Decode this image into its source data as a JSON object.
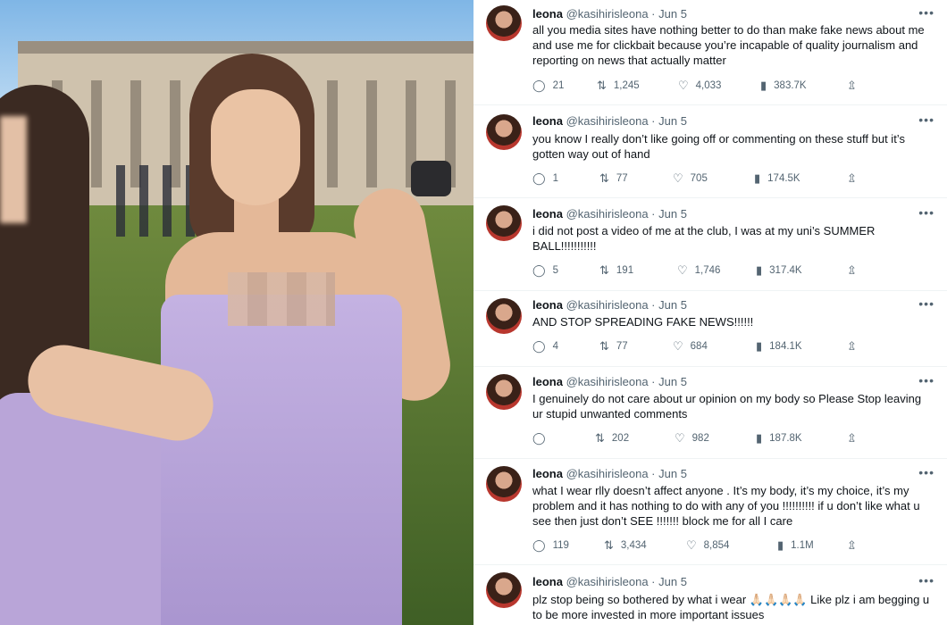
{
  "tweets": [
    {
      "name": "leona",
      "handle": "@kasihirisleona",
      "date": "Jun 5",
      "more": "•••",
      "text": "all you media sites have nothing better to do than make fake news about me and use me for clickbait because you’re incapable of quality journalism and reporting on news that actually matter",
      "replies": "21",
      "retweets": "1,245",
      "likes": "4,033",
      "views": "383.7K"
    },
    {
      "name": "leona",
      "handle": "@kasihirisleona",
      "date": "Jun 5",
      "more": "•••",
      "text": "you know I really don’t like going off or commenting on these stuff but it’s gotten way out of hand",
      "replies": "1",
      "retweets": "77",
      "likes": "705",
      "views": "174.5K"
    },
    {
      "name": "leona",
      "handle": "@kasihirisleona",
      "date": "Jun 5",
      "more": "•••",
      "text": "i did not post a video of me at the club, I was at my uni’s SUMMER BALL!!!!!!!!!!!",
      "replies": "5",
      "retweets": "191",
      "likes": "1,746",
      "views": "317.4K"
    },
    {
      "name": "leona",
      "handle": "@kasihirisleona",
      "date": "Jun 5",
      "more": "•••",
      "text": "AND STOP SPREADING FAKE NEWS!!!!!!",
      "replies": "4",
      "retweets": "77",
      "likes": "684",
      "views": "184.1K"
    },
    {
      "name": "leona",
      "handle": "@kasihirisleona",
      "date": "Jun 5",
      "more": "•••",
      "text": "I genuinely do not care about ur opinion on my body so Please Stop leaving ur stupid unwanted comments",
      "replies": "",
      "retweets": "202",
      "likes": "982",
      "views": "187.8K"
    },
    {
      "name": "leona",
      "handle": "@kasihirisleona",
      "date": "Jun 5",
      "more": "•••",
      "text": "what I wear rlly doesn’t affect anyone . It’s my body, it’s my choice, it’s my problem and it has nothing to do with any of you !!!!!!!!!! if u don’t like what u see then just don’t SEE !!!!!!! block me for all I care",
      "replies": "119",
      "retweets": "3,434",
      "likes": "8,854",
      "views": "1.1M"
    },
    {
      "name": "leona",
      "handle": "@kasihirisleona",
      "date": "Jun 5",
      "more": "•••",
      "text": "plz stop being so bothered by what i wear 🙏🏻🙏🏻🙏🏻🙏🏻 Like plz i am begging u to be more invested in more important issues",
      "replies": "",
      "retweets": "",
      "likes": "",
      "views": ""
    }
  ],
  "icons": {
    "reply": "reply-icon",
    "retweet": "retweet-icon",
    "like": "like-icon",
    "views": "views-icon",
    "share": "share-icon"
  }
}
